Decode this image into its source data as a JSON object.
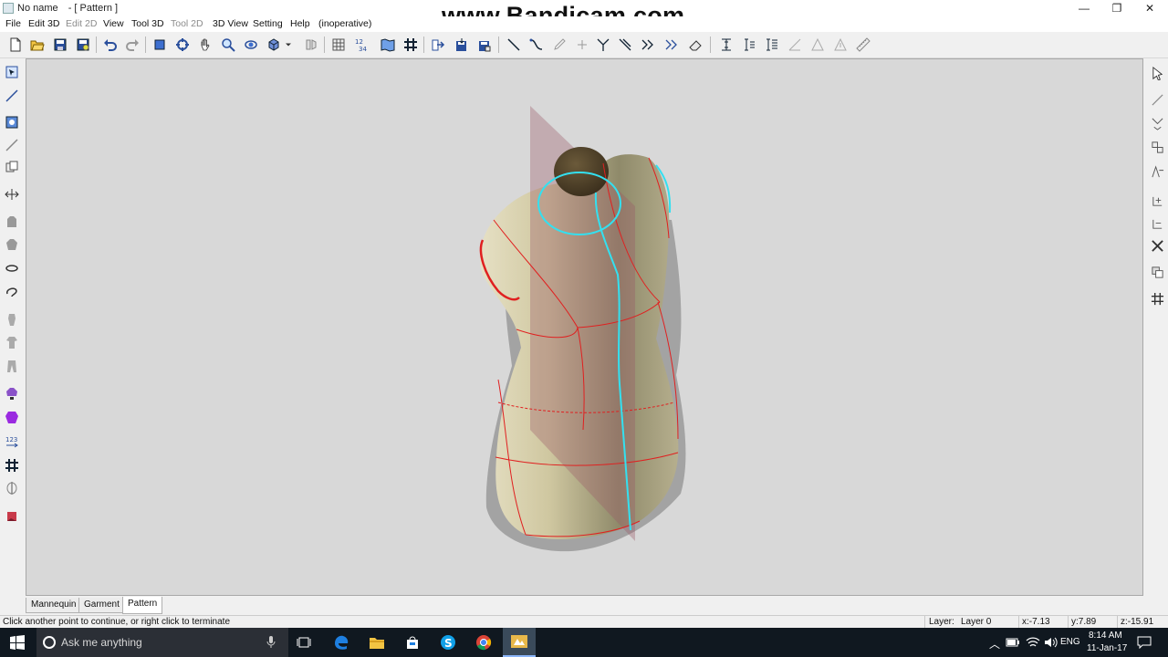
{
  "window": {
    "app_name": "No name",
    "doc_label": "- [ Pattern ]",
    "minimize": "—",
    "restore": "❐",
    "close": "✕"
  },
  "watermark": "www.Bandicam.com",
  "menu": [
    {
      "label": "File",
      "disabled": false
    },
    {
      "label": "Edit 3D",
      "disabled": false
    },
    {
      "label": "Edit 2D",
      "disabled": true
    },
    {
      "label": "View",
      "disabled": false
    },
    {
      "label": "Tool 3D",
      "disabled": false
    },
    {
      "label": "Tool 2D",
      "disabled": true
    },
    {
      "label": "3D View",
      "disabled": false
    },
    {
      "label": "Setting",
      "disabled": false
    },
    {
      "label": "Help",
      "disabled": false
    },
    {
      "label": "(inoperative)",
      "disabled": false
    }
  ],
  "tabs": [
    "Mannequin",
    "Garment",
    "Pattern"
  ],
  "active_tab": "Pattern",
  "status": {
    "message": "Click another point to continue, or right click to terminate",
    "layer_label": "Layer:",
    "layer_value": "Layer 0",
    "x": "x:-7.13",
    "y": "y:7.89",
    "z": "z:-15.91"
  },
  "taskbar": {
    "search_placeholder": "Ask me anything",
    "language": "ENG",
    "time": "8:14 AM",
    "date": "11-Jan-17"
  },
  "colors": {
    "viewport_bg": "#d8d8d8",
    "mannequin": "#bdb491",
    "pattern_line_red": "#e02020",
    "pattern_line_cyan": "#33e0f0",
    "taskbar": "#101820"
  }
}
